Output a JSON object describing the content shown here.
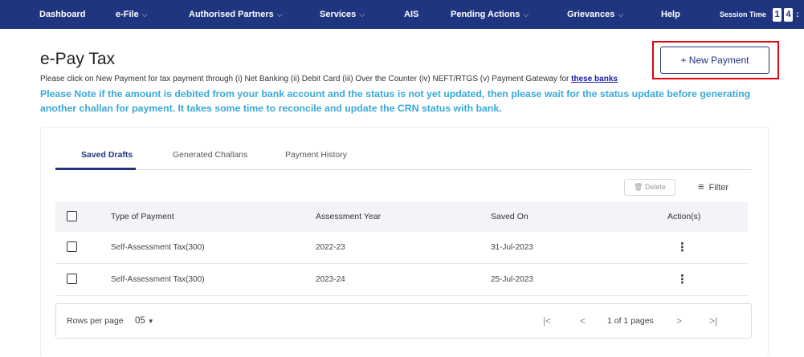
{
  "nav": {
    "dashboard": "Dashboard",
    "efile": "e-File",
    "partners": "Authorised Partners",
    "services": "Services",
    "ais": "AIS",
    "pending": "Pending Actions",
    "grievances": "Grievances",
    "help": "Help",
    "session_label": "Session Time",
    "session_digits": [
      "1",
      "4"
    ]
  },
  "page": {
    "title": "e-Pay Tax",
    "intro_text": "Please click on New Payment for tax payment through (i) Net Banking (ii) Debit Card (iii) Over the Counter (iv) NEFT/RTGS (v) Payment Gateway for ",
    "intro_link": "these banks",
    "notice": "Please Note if the amount is debited from your bank account and the status is not yet updated, then please wait for the status update before generating another challan for payment. It takes some time to reconcile and update the CRN status with bank.",
    "new_payment": "+ New Payment"
  },
  "tabs": [
    "Saved Drafts",
    "Generated Challans",
    "Payment History"
  ],
  "active_tab": "Saved Drafts",
  "toolbar": {
    "delete": "Delete",
    "filter": "Filter"
  },
  "table": {
    "headers": [
      "Type of Payment",
      "Assessment Year",
      "Saved On",
      "Action(s)"
    ],
    "rows": [
      {
        "type": "Self-Assessment Tax(300)",
        "year": "2022-23",
        "saved_on": "31-Jul-2023"
      },
      {
        "type": "Self-Assessment Tax(300)",
        "year": "2023-24",
        "saved_on": "25-Jul-2023"
      }
    ]
  },
  "pagination": {
    "rows_label": "Rows per page",
    "rows_value": "05",
    "pages": "1 of 1 pages"
  },
  "colors": {
    "nav_bg": "#1f3580",
    "notice": "#38a8d8",
    "highlight": "#e3000b"
  }
}
